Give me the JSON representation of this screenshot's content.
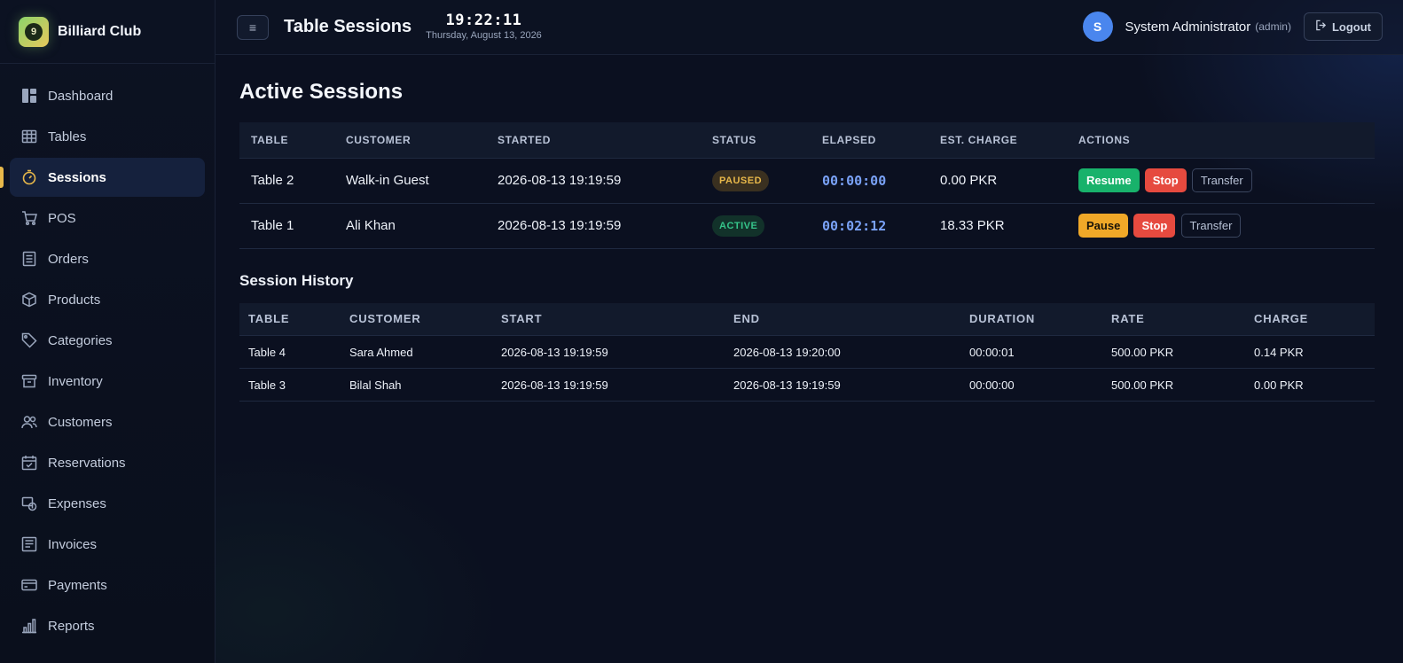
{
  "brand": {
    "name": "Billiard Club",
    "logo_glyph": "9"
  },
  "sidebar": {
    "items": [
      {
        "label": "Dashboard",
        "icon": "dashboard-icon"
      },
      {
        "label": "Tables",
        "icon": "table-grid-icon"
      },
      {
        "label": "Sessions",
        "icon": "stopwatch-icon",
        "active": true
      },
      {
        "label": "POS",
        "icon": "cart-icon"
      },
      {
        "label": "Orders",
        "icon": "receipt-icon"
      },
      {
        "label": "Products",
        "icon": "box-icon"
      },
      {
        "label": "Categories",
        "icon": "tag-icon"
      },
      {
        "label": "Inventory",
        "icon": "archive-icon"
      },
      {
        "label": "Customers",
        "icon": "users-icon"
      },
      {
        "label": "Reservations",
        "icon": "calendar-check-icon"
      },
      {
        "label": "Expenses",
        "icon": "expense-icon"
      },
      {
        "label": "Invoices",
        "icon": "invoice-icon"
      },
      {
        "label": "Payments",
        "icon": "credit-card-icon"
      },
      {
        "label": "Reports",
        "icon": "bar-chart-icon"
      }
    ]
  },
  "header": {
    "menu_glyph": "≡",
    "title": "Table Sessions",
    "clock_time": "19:22:11",
    "clock_date": "Thursday, August 13, 2026",
    "user_initial": "S",
    "user_name": "System Administrator",
    "user_role": "(admin)",
    "logout_label": "Logout"
  },
  "active_sessions": {
    "title": "Active Sessions",
    "columns": [
      "TABLE",
      "CUSTOMER",
      "STARTED",
      "STATUS",
      "ELAPSED",
      "EST. CHARGE",
      "ACTIONS"
    ],
    "rows": [
      {
        "table": "Table 2",
        "customer": "Walk-in Guest",
        "started": "2026-08-13 19:19:59",
        "status": "PAUSED",
        "elapsed": "00:00:00",
        "charge": "0.00 PKR",
        "actions": [
          "Resume",
          "Stop",
          "Transfer"
        ]
      },
      {
        "table": "Table 1",
        "customer": "Ali Khan",
        "started": "2026-08-13 19:19:59",
        "status": "ACTIVE",
        "elapsed": "00:02:12",
        "charge": "18.33 PKR",
        "actions": [
          "Pause",
          "Stop",
          "Transfer"
        ]
      }
    ]
  },
  "session_history": {
    "title": "Session History",
    "columns": [
      "TABLE",
      "CUSTOMER",
      "START",
      "END",
      "DURATION",
      "RATE",
      "CHARGE"
    ],
    "rows": [
      {
        "table": "Table 4",
        "customer": "Sara Ahmed",
        "start": "2026-08-13 19:19:59",
        "end": "2026-08-13 19:20:00",
        "duration": "00:00:01",
        "rate": "500.00 PKR",
        "charge": "0.14 PKR"
      },
      {
        "table": "Table 3",
        "customer": "Bilal Shah",
        "start": "2026-08-13 19:19:59",
        "end": "2026-08-13 19:19:59",
        "duration": "00:00:00",
        "rate": "500.00 PKR",
        "charge": "0.00 PKR"
      }
    ]
  },
  "colors": {
    "accent": "#e8b84a",
    "elapsed": "#7aa2f7",
    "resume": "#18b26b",
    "pause": "#f0a828",
    "stop": "#e64a3f"
  }
}
